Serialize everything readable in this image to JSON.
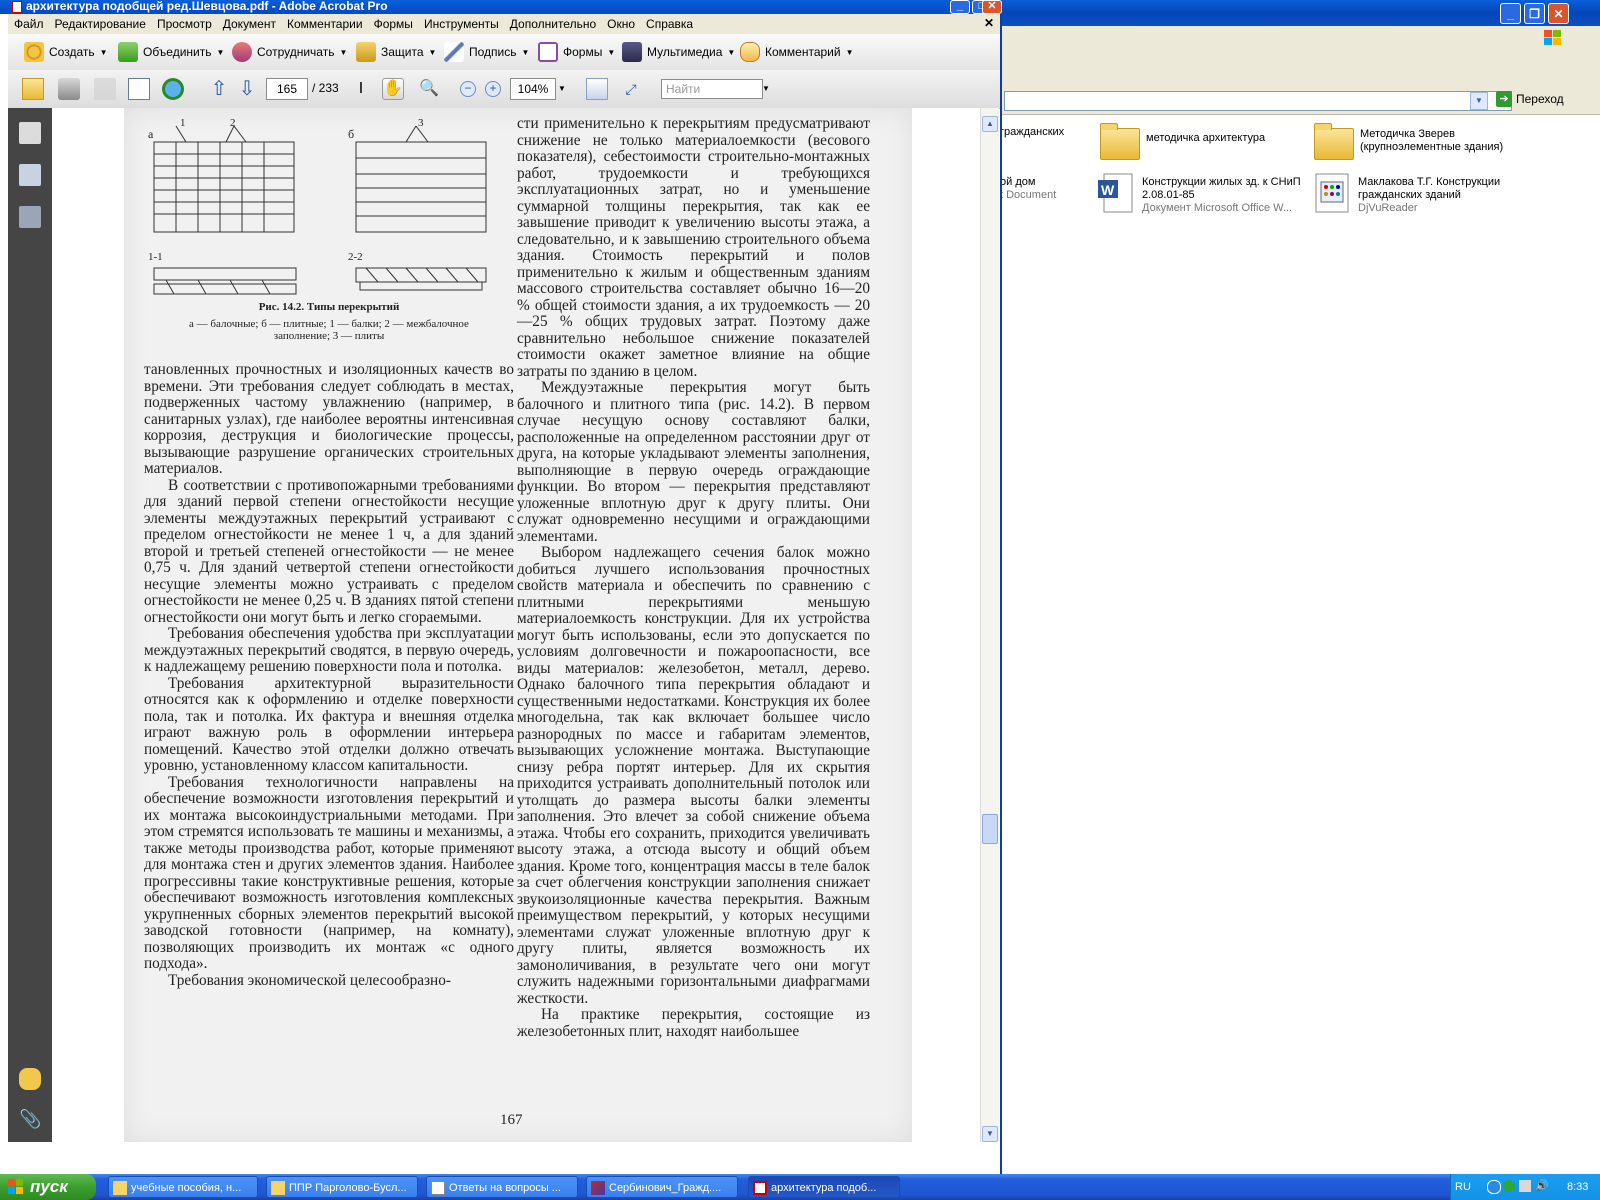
{
  "acrobat": {
    "title": "архитектура подобщей ред.Шевцова.pdf - Adobe Acrobat Pro",
    "menu": [
      "Файл",
      "Редактирование",
      "Просмотр",
      "Документ",
      "Комментарии",
      "Формы",
      "Инструменты",
      "Дополнительно",
      "Окно",
      "Справка"
    ],
    "toolbar_tasks": [
      "Создать",
      "Объединить",
      "Сотрудничать",
      "Защита",
      "Подпись",
      "Формы",
      "Мультимедиа",
      "Комментарий"
    ],
    "current_page": "165",
    "total_pages": "/ 233",
    "zoom": "104%",
    "find_placeholder": "Найти"
  },
  "explorer": {
    "go_label": "Переход",
    "files": [
      {
        "name": "гражданских",
        "sub": ""
      },
      {
        "name": "методичка архитектура",
        "sub": ""
      },
      {
        "name": "Методичка Зверев (крупноэлементные здания)",
        "sub": ""
      },
      {
        "name": "ой дом",
        "sub": "t Document"
      },
      {
        "name": "Конструкции жилых зд. к СНиП 2.08.01-85",
        "sub": "Документ Microsoft Office W..."
      },
      {
        "name": "Маклакова Т.Г. Конструкции гражданских зданий",
        "sub": "DjVuReader"
      }
    ]
  },
  "page": {
    "fig_label_a": "а",
    "fig_label_b": "б",
    "fig_label_1": "1",
    "fig_label_2": "2",
    "fig_label_3": "3",
    "fig_section_11": "1-1",
    "fig_section_22": "2-2",
    "caption_title": "Рис. 14.2. Типы перекрытий",
    "caption_text": "а — балочные; б — плитные; 1 — балки; 2 — межбалочное заполнение; 3 — плиты",
    "left_paragraphs": [
      "тановленных прочностных и изоляционных качеств во времени. Эти требования следует соблюдать в местах, подверженных частому увлажнению (например, в санитарных узлах), где наиболее вероятны интенсивная коррозия, деструкция и биологические процессы, вызывающие разрушение органических строительных материалов.",
      "В соответствии с противопожарными требованиями для зданий первой степени огнестойкости несущие элементы междуэтажных перекрытий устраивают с пределом огнестойкости не менее 1 ч, а для зданий второй и третьей степеней огнестойкости — не менее 0,75 ч. Для зданий четвертой степени огнестойкости несущие элементы можно устраивать с пределом огнестойкости не менее 0,25 ч. В зданиях пятой степени огнестойкости они могут быть и легко сгораемыми.",
      "Требования обеспечения удобства при эксплуатации междуэтажных перекрытий сводятся, в первую очередь, к надлежащему решению поверхности пола и потолка.",
      "Требования архитектурной выразительности относятся как к оформлению и отделке поверхности пола, так и потолка. Их фактура и внешняя отделка играют важную роль в оформлении интерьера помещений. Качество этой отделки должно отвечать уровню, установленному классом капитальности.",
      "Требования технологичности направлены на обеспечение возможности изготовления перекрытий и их монтажа высокоиндустриальными методами. При этом стремятся использовать те машины и механизмы, а также методы производства работ, которые применяют для монтажа стен и других элементов здания. Наиболее прогрессивны такие конструктивные решения, которые обеспечивают возможность изготовления комплексных укрупненных сборных элементов перекрытий высокой заводской готовности (например, на комнату), позволяющих производить их монтаж «с одного подхода».",
      "Требования экономической целесообразно-"
    ],
    "right_paragraphs": [
      "сти применительно к перекрытиям предусматривают снижение не только материалоемкости (весового показателя), себестоимости строительно-монтажных работ, трудоемкости и требующихся эксплуатационных затрат, но и уменьшение суммарной толщины перекрытия, так как ее завышение приводит к увеличению высоты этажа, а следовательно, и к завышению строительного объема здания. Стоимость перекрытий и полов применительно к жилым и общественным зданиям массового строительства составляет обычно 16—20 % общей стоимости здания, а их трудоемкость — 20—25 % общих трудовых затрат. Поэтому даже сравнительно небольшое снижение показателей стоимости окажет заметное влияние на общие затраты по зданию в целом.",
      "Междуэтажные перекрытия могут быть балочного и плитного типа (рис. 14.2). В первом случае несущую основу составляют балки, расположенные на определенном расстоянии друг от друга, на которые укладывают элементы заполнения, выполняющие в первую очередь ограждающие функции. Во втором — перекрытия представляют уложенные вплотную друг к другу плиты. Они служат одновременно несущими и ограждающими элементами.",
      "Выбором надлежащего сечения балок можно добиться лучшего использования прочностных свойств материала и обеспечить по сравнению с плитными перекрытиями меньшую материалоемкость конструкции. Для их устройства могут быть использованы, если это допускается по условиям долговечности и пожароопасности, все виды материалов: железобетон, металл, дерево. Однако балочного типа перекрытия обладают и существенными недостатками. Конструкция их более многодельна, так как включает большее число разнородных по массе и габаритам элементов, вызывающих усложнение монтажа. Выступающие снизу ребра портят интерьер. Для их скрытия приходится устраивать дополнительный потолок или утолщать до размера высоты балки элементы заполнения. Это влечет за собой снижение объема этажа. Чтобы его сохранить, приходится увеличивать высоту этажа, а отсюда высоту и общий объем здания. Кроме того, концентрация массы в теле балок за счет облегчения конструкции заполнения снижает звукоизоляционные качества перекрытия. Важным преимуществом перекрытий, у которых несущими элементами служат уложенные вплотную друг к другу плиты, является возможность их замоноличивания, в результате чего они могут служить надежными горизонтальными диафрагмами жесткости.",
      "На практике перекрытия, состоящие из железобетонных плит, находят наибольшее"
    ],
    "page_number": "167"
  },
  "taskbar": {
    "start_label": "пуск",
    "tasks": [
      {
        "label": "учебные пособия, н..."
      },
      {
        "label": "ППР Парголово-Бусл..."
      },
      {
        "label": "Ответы на вопросы ..."
      },
      {
        "label": "Сербинович_Гражд...."
      },
      {
        "label": "архитектура подоб..."
      }
    ],
    "lang": "RU",
    "clock": "8:33"
  }
}
